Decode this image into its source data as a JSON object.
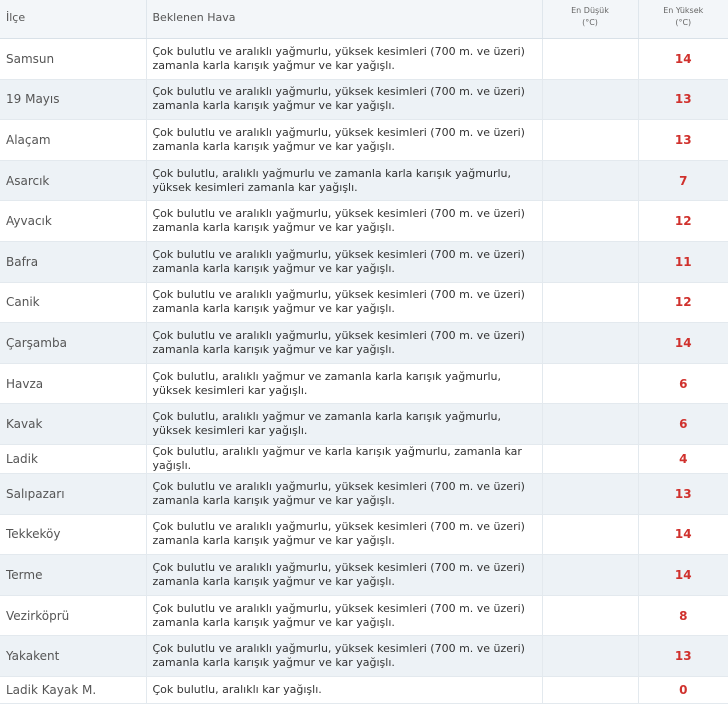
{
  "header": {
    "ilce": "İlçe",
    "hava": "Beklenen Hava",
    "min_line1": "En Düşük",
    "min_line2": "(°C)",
    "max_line1": "En Yüksek",
    "max_line2": "(°C)"
  },
  "rows": [
    {
      "ilce": "Samsun",
      "hava": "Çok bulutlu ve aralıklı yağmurlu, yüksek kesimleri (700 m. ve üzeri) zamanla karla karışık yağmur ve kar yağışlı.",
      "min": "",
      "max": "14"
    },
    {
      "ilce": "19 Mayıs",
      "hava": "Çok bulutlu ve aralıklı yağmurlu, yüksek kesimleri (700 m. ve üzeri) zamanla karla karışık yağmur ve kar yağışlı.",
      "min": "",
      "max": "13"
    },
    {
      "ilce": "Alaçam",
      "hava": "Çok bulutlu ve aralıklı yağmurlu, yüksek kesimleri (700 m. ve üzeri) zamanla karla karışık yağmur ve kar yağışlı.",
      "min": "",
      "max": "13"
    },
    {
      "ilce": "Asarcık",
      "hava": "Çok bulutlu, aralıklı yağmurlu ve zamanla karla karışık yağmurlu, yüksek kesimleri zamanla kar yağışlı.",
      "min": "",
      "max": "7"
    },
    {
      "ilce": "Ayvacık",
      "hava": "Çok bulutlu ve aralıklı yağmurlu, yüksek kesimleri (700 m. ve üzeri) zamanla karla karışık yağmur ve kar yağışlı.",
      "min": "",
      "max": "12"
    },
    {
      "ilce": "Bafra",
      "hava": "Çok bulutlu ve aralıklı yağmurlu, yüksek kesimleri (700 m. ve üzeri) zamanla karla karışık yağmur ve kar yağışlı.",
      "min": "",
      "max": "11"
    },
    {
      "ilce": "Canik",
      "hava": "Çok bulutlu ve aralıklı yağmurlu, yüksek kesimleri (700 m. ve üzeri) zamanla karla karışık yağmur ve kar yağışlı.",
      "min": "",
      "max": "12"
    },
    {
      "ilce": "Çarşamba",
      "hava": "Çok bulutlu ve aralıklı yağmurlu, yüksek kesimleri (700 m. ve üzeri) zamanla karla karışık yağmur ve kar yağışlı.",
      "min": "",
      "max": "14"
    },
    {
      "ilce": "Havza",
      "hava": "Çok bulutlu, aralıklı yağmur ve zamanla karla karışık yağmurlu, yüksek kesimleri kar yağışlı.",
      "min": "",
      "max": "6"
    },
    {
      "ilce": "Kavak",
      "hava": "Çok bulutlu, aralıklı yağmur ve zamanla karla karışık yağmurlu, yüksek kesimleri kar yağışlı.",
      "min": "",
      "max": "6"
    },
    {
      "ilce": "Ladik",
      "hava": "Çok bulutlu, aralıklı yağmur ve karla karışık yağmurlu, zamanla kar yağışlı.",
      "min": "",
      "max": "4",
      "single": true
    },
    {
      "ilce": "Salıpazarı",
      "hava": "Çok bulutlu ve aralıklı yağmurlu, yüksek kesimleri (700 m. ve üzeri) zamanla karla karışık yağmur ve kar yağışlı.",
      "min": "",
      "max": "13"
    },
    {
      "ilce": "Tekkeköy",
      "hava": "Çok bulutlu ve aralıklı yağmurlu, yüksek kesimleri (700 m. ve üzeri) zamanla karla karışık yağmur ve kar yağışlı.",
      "min": "",
      "max": "14"
    },
    {
      "ilce": "Terme",
      "hava": "Çok bulutlu ve aralıklı yağmurlu, yüksek kesimleri (700 m. ve üzeri) zamanla karla karışık yağmur ve kar yağışlı.",
      "min": "",
      "max": "14"
    },
    {
      "ilce": "Vezirköprü",
      "hava": "Çok bulutlu ve aralıklı yağmurlu, yüksek kesimleri (700 m. ve üzeri) zamanla karla karışık yağmur ve kar yağışlı.",
      "min": "",
      "max": "8"
    },
    {
      "ilce": "Yakakent",
      "hava": "Çok bulutlu ve aralıklı yağmurlu, yüksek kesimleri (700 m. ve üzeri) zamanla karla karışık yağmur ve kar yağışlı.",
      "min": "",
      "max": "13"
    },
    {
      "ilce": "Ladik Kayak M.",
      "hava": "Çok bulutlu, aralıklı kar yağışlı.",
      "min": "",
      "max": "0",
      "single": true
    }
  ]
}
